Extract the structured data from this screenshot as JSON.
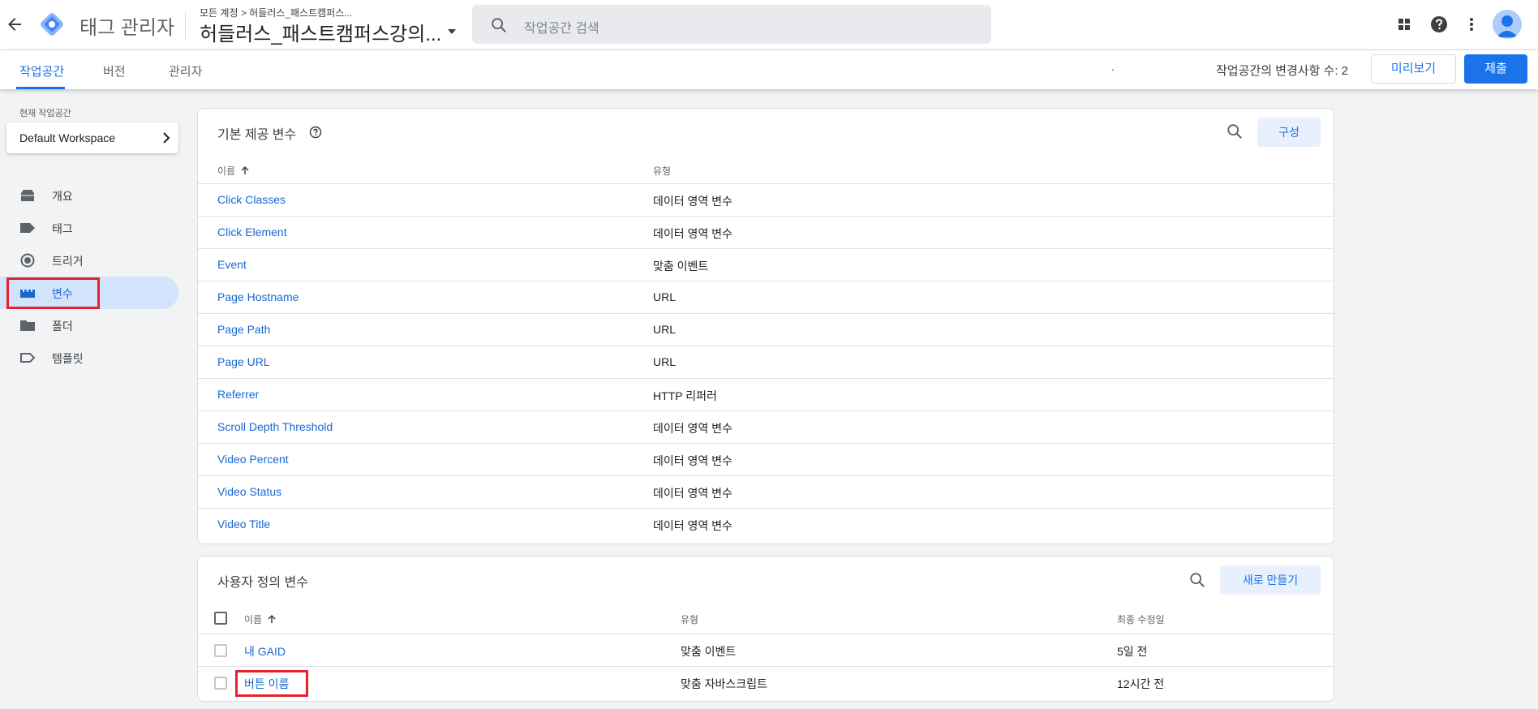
{
  "header": {
    "app_title": "태그 관리자",
    "breadcrumb": "모든 계정 > 허들러스_패스트캠퍼스...",
    "container_name": "허들러스_패스트캠퍼스강의...",
    "search_placeholder": "작업공간 검색",
    "icons": [
      "back-arrow-icon",
      "gtm-logo",
      "apps-grid-icon",
      "help-icon",
      "more-vert-icon",
      "account-avatar"
    ]
  },
  "tabs": [
    {
      "label": "작업공간",
      "active": true
    },
    {
      "label": "버전",
      "active": false
    },
    {
      "label": "관리자",
      "active": false
    }
  ],
  "toolbar": {
    "dot": ".",
    "changes_label": "작업공간의 변경사항 수: 2",
    "preview_label": "미리보기",
    "submit_label": "제출"
  },
  "sidebar": {
    "workspace_label": "현재 작업공간",
    "workspace_name": "Default Workspace",
    "items": [
      {
        "label": "개요",
        "icon": "overview-icon"
      },
      {
        "label": "태그",
        "icon": "tag-icon"
      },
      {
        "label": "트리거",
        "icon": "trigger-icon"
      },
      {
        "label": "변수",
        "icon": "variables-icon",
        "active": true
      },
      {
        "label": "폴더",
        "icon": "folder-icon"
      },
      {
        "label": "템플릿",
        "icon": "template-icon"
      }
    ]
  },
  "builtin": {
    "title": "기본 제공 변수",
    "configure_label": "구성",
    "col_name": "이름",
    "col_type": "유형",
    "rows": [
      {
        "name": "Click Classes",
        "type": "데이터 영역 변수"
      },
      {
        "name": "Click Element",
        "type": "데이터 영역 변수"
      },
      {
        "name": "Event",
        "type": "맞춤 이벤트"
      },
      {
        "name": "Page Hostname",
        "type": "URL"
      },
      {
        "name": "Page Path",
        "type": "URL"
      },
      {
        "name": "Page URL",
        "type": "URL"
      },
      {
        "name": "Referrer",
        "type": "HTTP 리퍼러"
      },
      {
        "name": "Scroll Depth Threshold",
        "type": "데이터 영역 변수"
      },
      {
        "name": "Video Percent",
        "type": "데이터 영역 변수"
      },
      {
        "name": "Video Status",
        "type": "데이터 영역 변수"
      },
      {
        "name": "Video Title",
        "type": "데이터 영역 변수"
      }
    ]
  },
  "user_defined": {
    "title": "사용자 정의 변수",
    "new_label": "새로 만들기",
    "col_name": "이름",
    "col_type": "유형",
    "col_modified": "최종 수정일",
    "rows": [
      {
        "name": "내 GAID",
        "type": "맞춤 이벤트",
        "modified": "5일 전"
      },
      {
        "name": "버튼 이름",
        "type": "맞춤 자바스크립트",
        "modified": "12시간 전"
      }
    ]
  },
  "colors": {
    "accent": "#1a73e8",
    "highlight_box": "#e5202f",
    "active_nav_bg": "#d2e3fc"
  }
}
